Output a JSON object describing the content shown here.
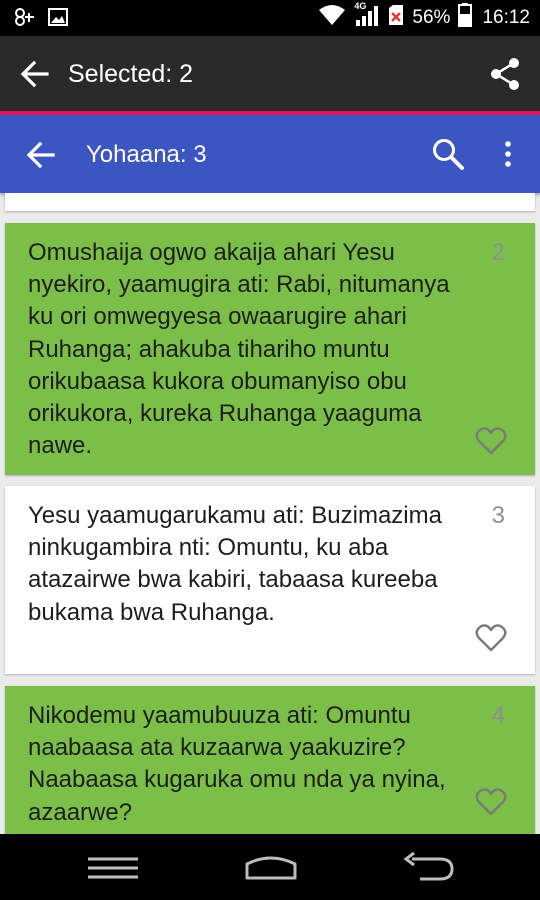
{
  "status_bar": {
    "icons": [
      "notification-app-icon",
      "image-icon",
      "wifi-icon",
      "signal-4g-icon",
      "no-sim-icon",
      "battery-icon"
    ],
    "network_label": "4G",
    "battery_percent": "56%",
    "time": "16:12"
  },
  "action_bar": {
    "title": "Selected: 2",
    "back_icon": "arrow-back-icon",
    "share_icon": "share-icon",
    "accent_color": "#e2155b"
  },
  "toolbar": {
    "title": "Yohaana: 3",
    "back_icon": "arrow-back-icon",
    "search_icon": "search-icon",
    "more_icon": "more-vert-icon",
    "color": "#3b55c2"
  },
  "verses": [
    {
      "number": "2",
      "selected": true,
      "text": "Omushaija ogwo akaija ahari Yesu nyekiro, yaamugira ati: Rabi, nitumanya ku ori omwegyesa owaarugire ahari Ruhanga; ahakuba tihariho muntu orikubaasa kukora obumanyiso obu orikukora, kureka Ruhanga yaaguma nawe."
    },
    {
      "number": "3",
      "selected": false,
      "text": "Yesu yaamugarukamu ati: Buzimazima ninkugambira nti: Omuntu, ku aba atazairwe bwa kabiri, tabaasa kureeba bukama bwa Ruhanga."
    },
    {
      "number": "4",
      "selected": true,
      "text": "Nikodemu yaamubuuza ati: Omuntu naabaasa ata kuzaarwa yaakuzire? Naabaasa kugaruka omu nda ya nyina, azaarwe?"
    }
  ],
  "selected_color": "#7bbf49",
  "nav_bar": {
    "icons": [
      "recent-apps-icon",
      "home-icon",
      "back-icon"
    ]
  }
}
